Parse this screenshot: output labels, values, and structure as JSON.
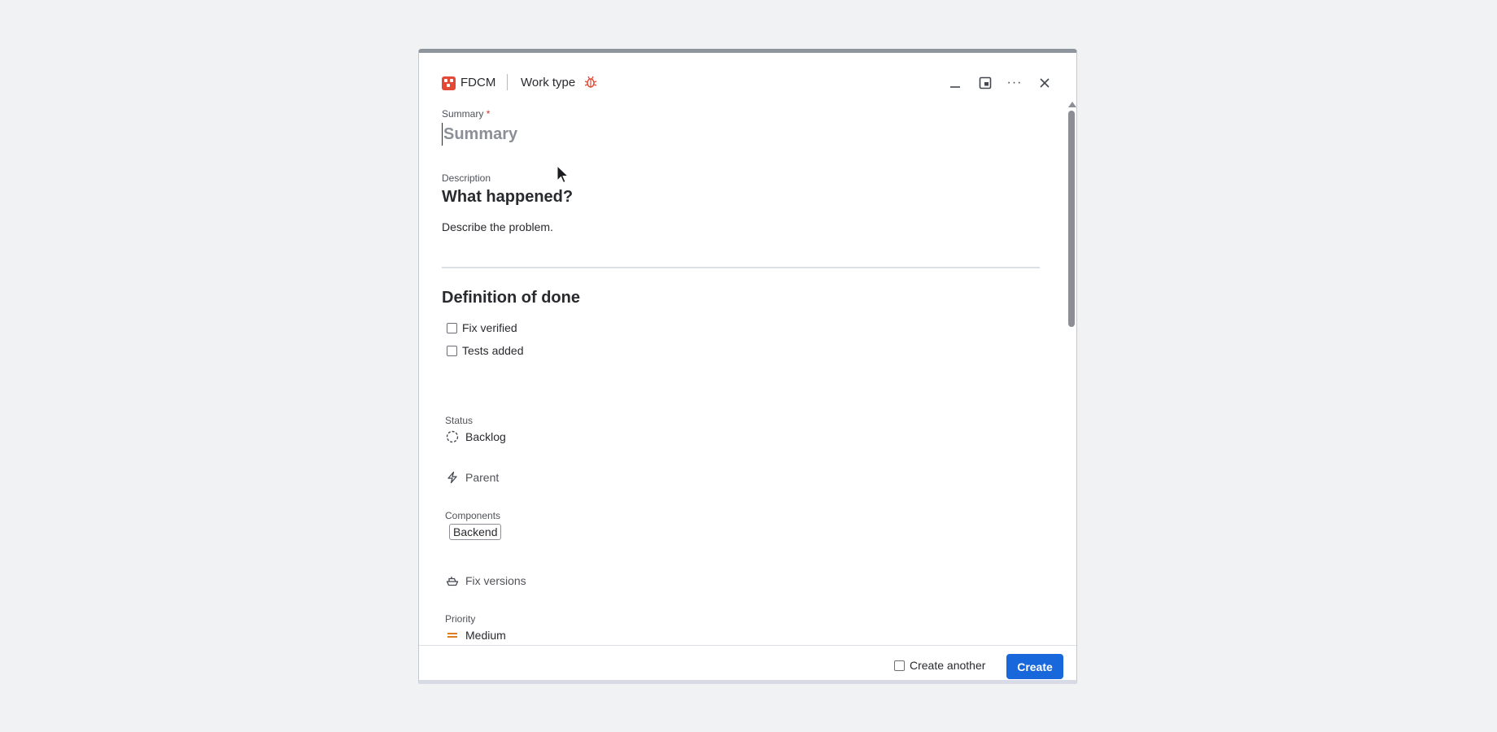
{
  "header": {
    "project_name": "FDCM",
    "work_type_label": "Work type",
    "more_label": "···"
  },
  "form": {
    "summary": {
      "label": "Summary",
      "required_mark": "*",
      "placeholder": "Summary",
      "value": ""
    },
    "description": {
      "label": "Description",
      "heading": "What happened?",
      "text": "Describe the problem.",
      "dod_heading": "Definition of done",
      "checklist": [
        "Fix verified",
        "Tests added"
      ]
    },
    "status": {
      "label": "Status",
      "value": "Backlog"
    },
    "parent": {
      "value": "Parent"
    },
    "components": {
      "label": "Components",
      "tag": "Backend"
    },
    "fix_versions": {
      "value": "Fix versions"
    },
    "priority": {
      "label": "Priority",
      "value": "Medium"
    }
  },
  "footer": {
    "create_another_label": "Create another",
    "create_button_label": "Create"
  },
  "colors": {
    "accent": "#1868db",
    "project_icon": "#e34935",
    "bug_icon": "#e34935",
    "required": "#c9372c",
    "priority_medium": "#d97008"
  },
  "icons": {
    "project": "project-icon",
    "work_type": "bug-icon",
    "minimize": "minimize-icon",
    "picture_in_picture": "pip-icon",
    "more": "more-icon",
    "close": "close-icon",
    "status": "status-circle-icon",
    "parent": "parent-icon",
    "fix_versions": "ship-icon",
    "priority": "priority-medium-icon"
  }
}
